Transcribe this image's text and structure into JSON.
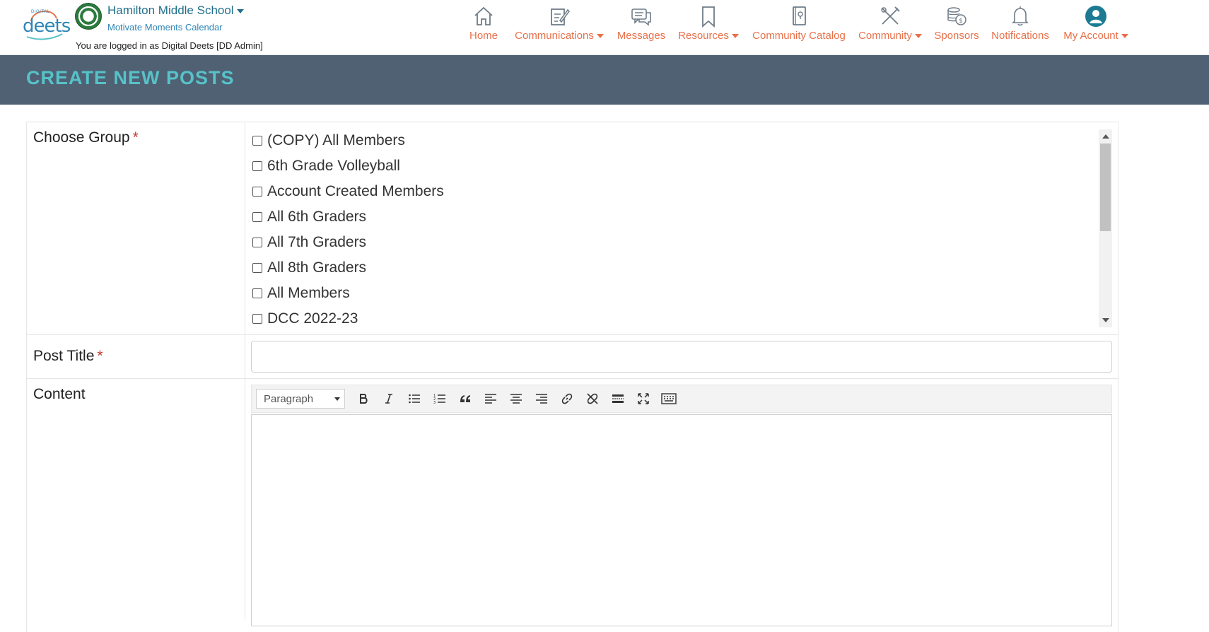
{
  "brand": {
    "logo_small": "DIGITAL",
    "logo_main": "deets"
  },
  "school": {
    "name": "Hamilton Middle School",
    "subtitle": "Motivate Moments Calendar",
    "logged_in": "You are logged in as Digital Deets [DD Admin]"
  },
  "nav": [
    {
      "label": "Home",
      "icon": "home-icon"
    },
    {
      "label": "Communications",
      "icon": "edit-note-icon",
      "dropdown": true
    },
    {
      "label": "Messages",
      "icon": "chat-bubbles-icon"
    },
    {
      "label": "Resources",
      "icon": "bookmark-icon",
      "dropdown": true
    },
    {
      "label": "Community Catalog",
      "icon": "catalog-book-icon"
    },
    {
      "label": "Community",
      "icon": "tools-icon",
      "dropdown": true
    },
    {
      "label": "Sponsors",
      "icon": "coins-icon"
    },
    {
      "label": "Notifications",
      "icon": "bell-icon"
    },
    {
      "label": "My Account",
      "icon": "user-avatar-icon",
      "dropdown": true
    }
  ],
  "page": {
    "title": "CREATE NEW POSTS"
  },
  "form": {
    "group_label": "Choose Group",
    "required_mark": "*",
    "groups": [
      "(COPY) All Members",
      "6th Grade Volleyball",
      "Account Created Members",
      "All 6th Graders",
      "All 7th Graders",
      "All 8th Graders",
      "All Members",
      "DCC 2022-23"
    ],
    "post_title_label": "Post Title",
    "post_title_value": "",
    "content_label": "Content",
    "format_value": "Paragraph"
  },
  "colors": {
    "nav_accent": "#e8704a",
    "title_band": "#4f6173",
    "title_text": "#57c2c9",
    "link_blue": "#1f6f8b"
  }
}
